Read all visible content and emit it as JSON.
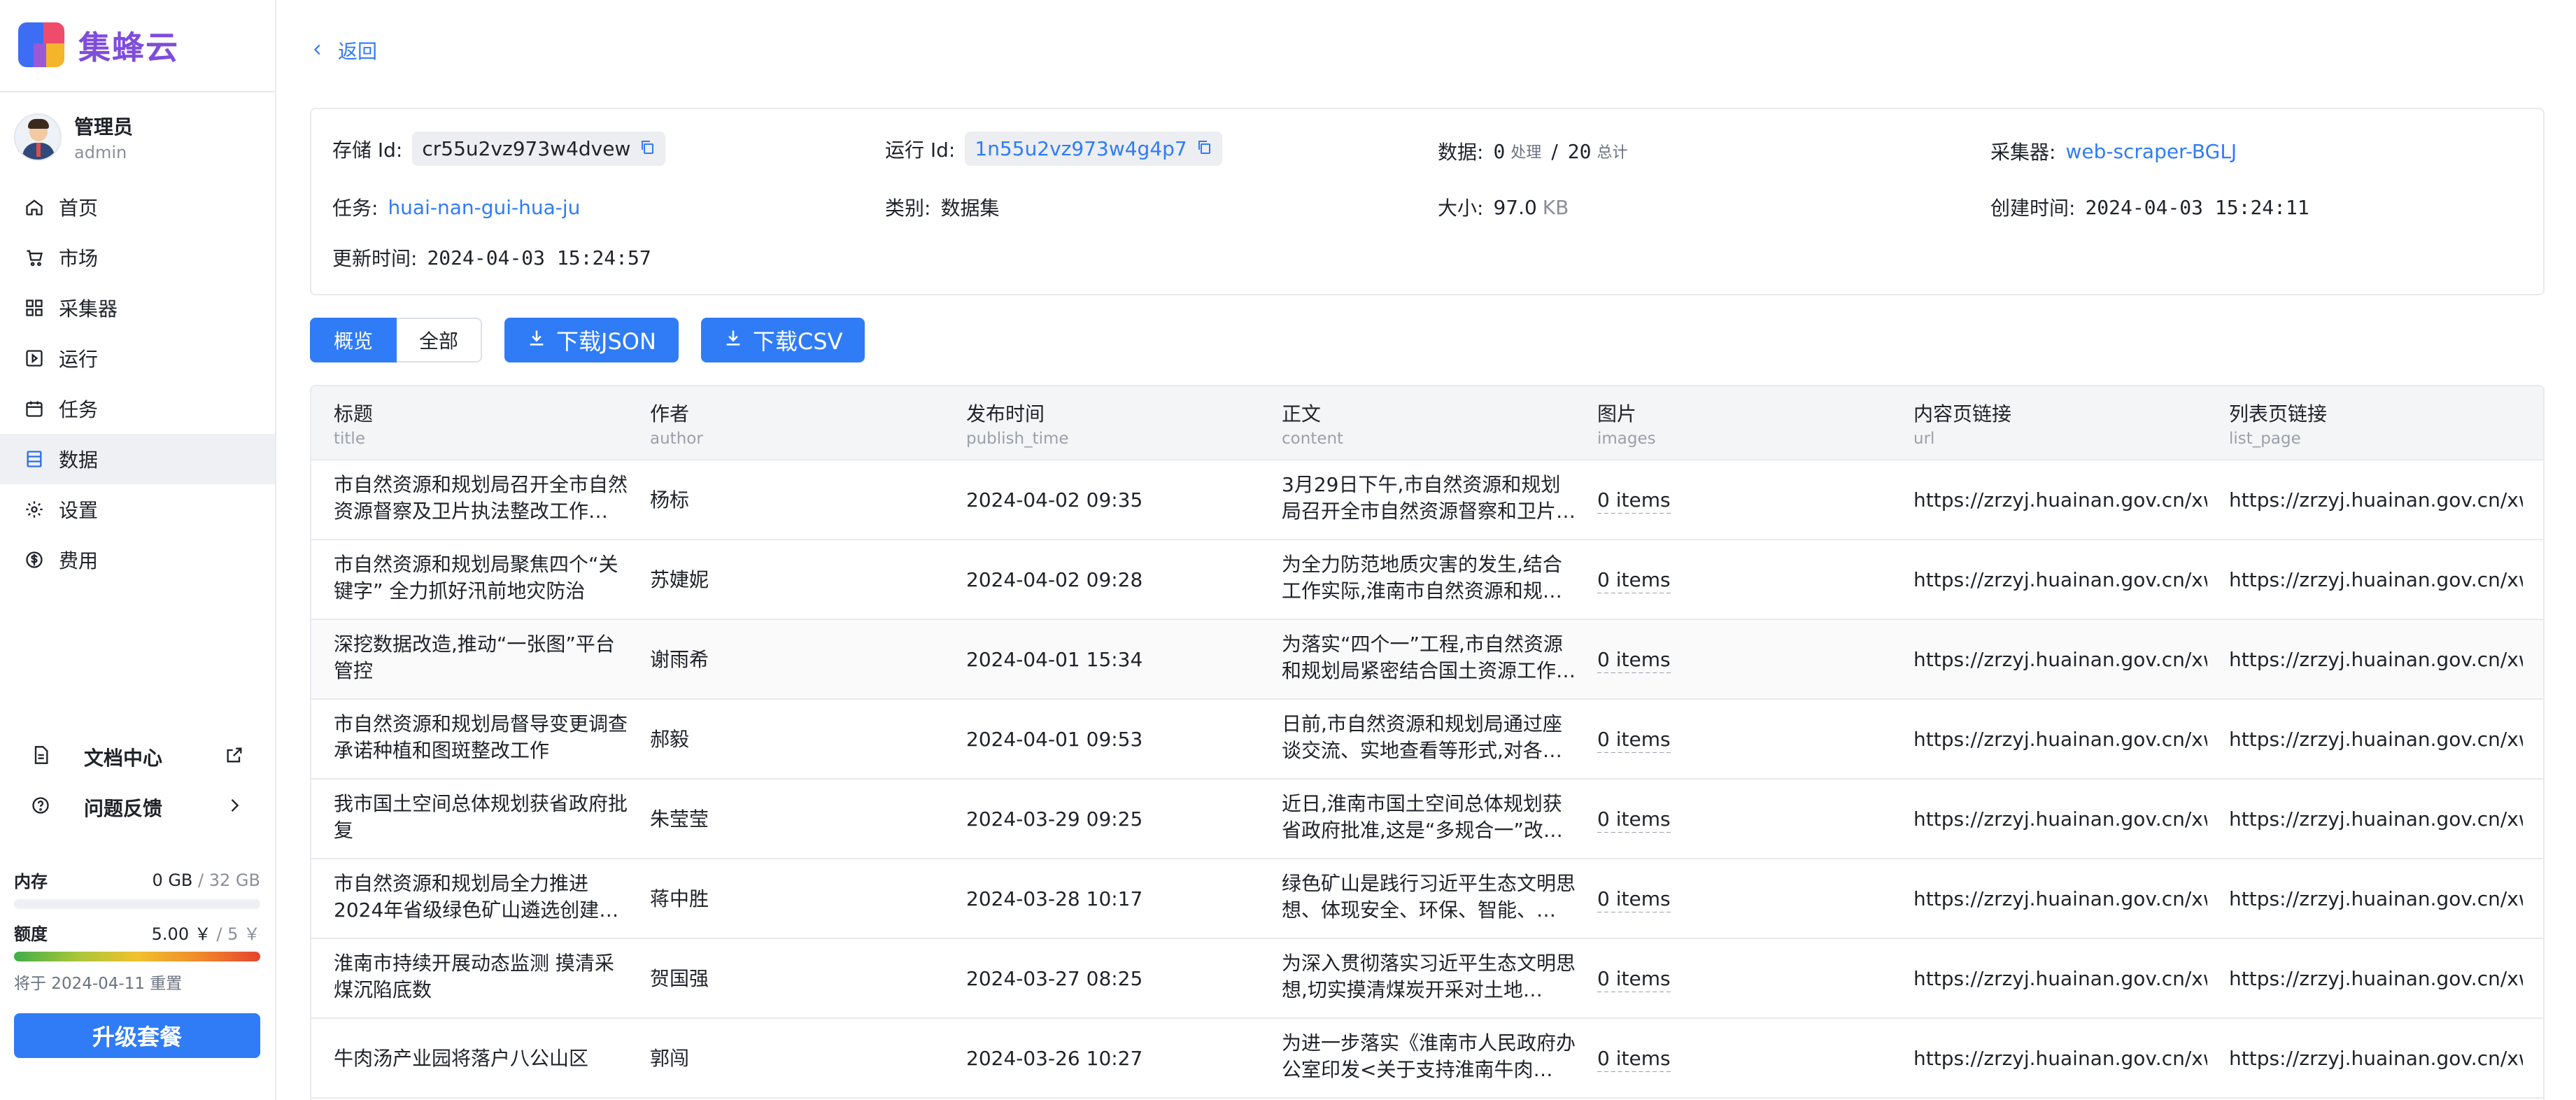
{
  "brand": {
    "name": "集蜂云"
  },
  "user": {
    "name": "管理员",
    "role": "admin"
  },
  "nav": [
    {
      "label": "首页",
      "icon": "home-icon"
    },
    {
      "label": "市场",
      "icon": "cart-icon"
    },
    {
      "label": "采集器",
      "icon": "collector-icon"
    },
    {
      "label": "运行",
      "icon": "run-icon"
    },
    {
      "label": "任务",
      "icon": "task-icon"
    },
    {
      "label": "数据",
      "icon": "data-icon",
      "active": true
    },
    {
      "label": "设置",
      "icon": "gear-icon"
    },
    {
      "label": "费用",
      "icon": "dollar-icon"
    }
  ],
  "bottom_links": {
    "docs": "文档中心",
    "feedback": "问题反馈"
  },
  "usage": {
    "memory_label": "内存",
    "memory_used": "0 GB",
    "memory_total": "/ 32 GB",
    "memory_fraction": 0,
    "quota_label": "额度",
    "quota_used": "5.00 ￥",
    "quota_total": "/ 5 ￥",
    "quota_fraction": 1,
    "reset_note": "将于 2024-04-11 重置"
  },
  "upgrade_label": "升级套餐",
  "back_label": "返回",
  "info": {
    "storage_label": "存储 Id:",
    "storage_id": "cr55u2vz973w4dvew",
    "run_label": "运行 Id:",
    "run_id": "1n55u2vz973w4g4p7",
    "data_label": "数据:",
    "data_processed": "0",
    "data_processed_unit": "处理",
    "data_sep": "/",
    "data_total": "20",
    "data_total_unit": "总计",
    "collector_label": "采集器:",
    "collector": "web-scraper-BGLJ",
    "task_label": "任务:",
    "task": "huai-nan-gui-hua-ju",
    "category_label": "类别:",
    "category": "数据集",
    "size_label": "大小:",
    "size_value": "97.0",
    "size_unit": "KB",
    "created_label": "创建时间:",
    "created": "2024-04-03 15:24:11",
    "updated_label": "更新时间:",
    "updated": "2024-04-03 15:24:57"
  },
  "toolbar": {
    "overview": "概览",
    "all": "全部",
    "download_json": "下载JSON",
    "download_csv": "下载CSV"
  },
  "table": {
    "columns": [
      {
        "label": "标题",
        "key": "title"
      },
      {
        "label": "作者",
        "key": "author"
      },
      {
        "label": "发布时间",
        "key": "publish_time"
      },
      {
        "label": "正文",
        "key": "content"
      },
      {
        "label": "图片",
        "key": "images"
      },
      {
        "label": "内容页链接",
        "key": "url"
      },
      {
        "label": "列表页链接",
        "key": "list_page"
      }
    ],
    "rows": [
      {
        "title": "市自然资源和规划局召开全市自然资源督察及卫片执法整改工作…",
        "author": "杨标",
        "time": "2024-04-02 09:35",
        "content": "3月29日下午,市自然资源和规划局召开全市自然资源督察和卫片…",
        "images": "0 items",
        "url": "https://zrzyj.huainan.gov.cn/xwzx",
        "list": "https://zrzyj.huainan.gov.cn/xwzx"
      },
      {
        "title": "市自然资源和规划局聚焦四个“关键字” 全力抓好汛前地灾防治",
        "author": "苏婕妮",
        "time": "2024-04-02 09:28",
        "content": "为全力防范地质灾害的发生,结合工作实际,淮南市自然资源和规…",
        "images": "0 items",
        "url": "https://zrzyj.huainan.gov.cn/xwzx",
        "list": "https://zrzyj.huainan.gov.cn/xwzx"
      },
      {
        "title": "深挖数据改造,推动“一张图”平台管控",
        "author": "谢雨希",
        "time": "2024-04-01 15:34",
        "content": "为落实“四个一”工程,市自然资源和规划局紧密结合国土资源工作…",
        "images": "0 items",
        "url": "https://zrzyj.huainan.gov.cn/xwzx",
        "list": "https://zrzyj.huainan.gov.cn/xwzx"
      },
      {
        "title": "市自然资源和规划局督导变更调查承诺种植和图斑整改工作",
        "author": "郝毅",
        "time": "2024-04-01 09:53",
        "content": "日前,市自然资源和规划局通过座谈交流、实地查看等形式,对各…",
        "images": "0 items",
        "url": "https://zrzyj.huainan.gov.cn/xwzx",
        "list": "https://zrzyj.huainan.gov.cn/xwzx"
      },
      {
        "title": "我市国土空间总体规划获省政府批复",
        "author": "朱莹莹",
        "time": "2024-03-29 09:25",
        "content": "近日,淮南市国土空间总体规划获省政府批准,这是“多规合一”改…",
        "images": "0 items",
        "url": "https://zrzyj.huainan.gov.cn/xwzx",
        "list": "https://zrzyj.huainan.gov.cn/xwzx"
      },
      {
        "title": "市自然资源和规划局全力推进2024年省级绿色矿山遴选创建…",
        "author": "蒋中胜",
        "time": "2024-03-28 10:17",
        "content": "绿色矿山是践行习近平生态文明思想、体现安全、环保、智能、…",
        "images": "0 items",
        "url": "https://zrzyj.huainan.gov.cn/xwzx",
        "list": "https://zrzyj.huainan.gov.cn/xwzx"
      },
      {
        "title": "淮南市持续开展动态监测 摸清采煤沉陷底数",
        "author": "贺国强",
        "time": "2024-03-27 08:25",
        "content": "为深入贯彻落实习近平生态文明思想,切实摸清煤炭开采对土地…",
        "images": "0 items",
        "url": "https://zrzyj.huainan.gov.cn/xwzx",
        "list": "https://zrzyj.huainan.gov.cn/xwzx"
      },
      {
        "title": "牛肉汤产业园将落户八公山区",
        "author": "郭闯",
        "time": "2024-03-26 10:27",
        "content": "为进一步落实《淮南市人民政府办公室印发<关于支持淮南牛肉…",
        "images": "0 items",
        "url": "https://zrzyj.huainan.gov.cn/xwzx",
        "list": "https://zrzyj.huainan.gov.cn/xwzx"
      }
    ]
  }
}
